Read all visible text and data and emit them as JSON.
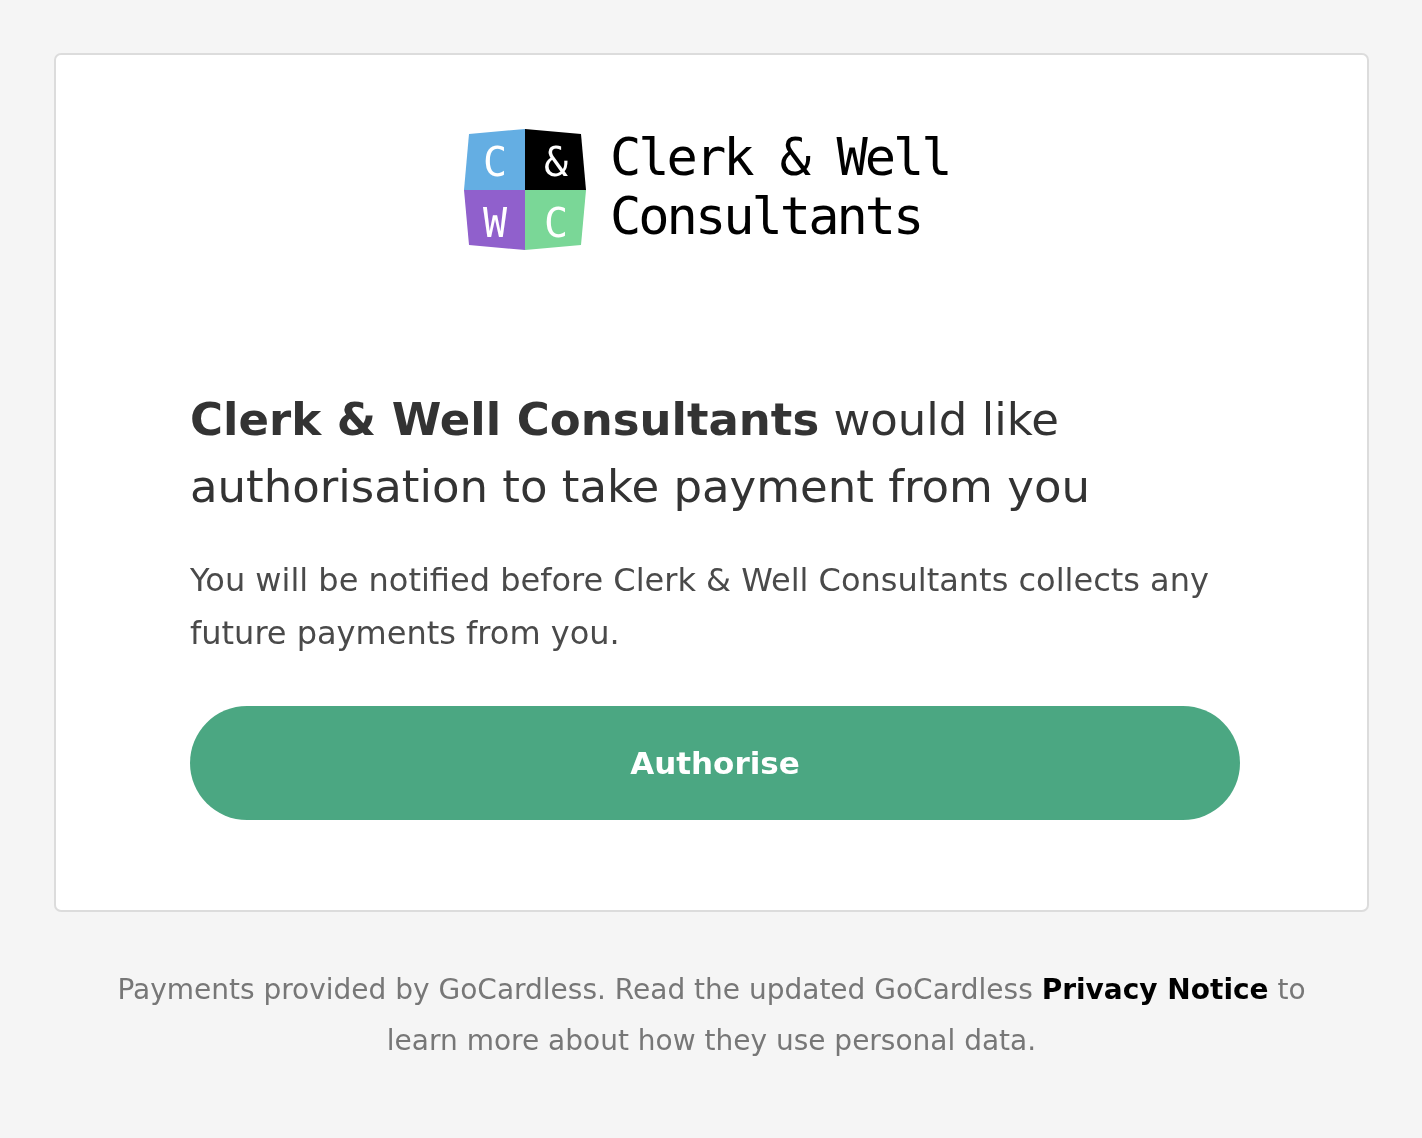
{
  "logo": {
    "tiles": [
      {
        "letter": "C",
        "color": "#64aee3"
      },
      {
        "letter": "&",
        "color": "#000000"
      },
      {
        "letter": "W",
        "color": "#9060cc"
      },
      {
        "letter": "C",
        "color": "#7ad797"
      }
    ],
    "wordmark": "Clerk & Well Consultants"
  },
  "heading": "**Clerk & Well Consultants** would like authorisation to take payment from you",
  "notice": "You will be notified before Clerk & Well Consultants collects any future payments from you.",
  "authorise_button": {
    "label": "Authorise"
  },
  "footer": {
    "text_before": "Payments provided by GoCardless. Read the updated GoCardless",
    "link": "Privacy Notice",
    "text_after": "to learn more about how they use personal data."
  }
}
